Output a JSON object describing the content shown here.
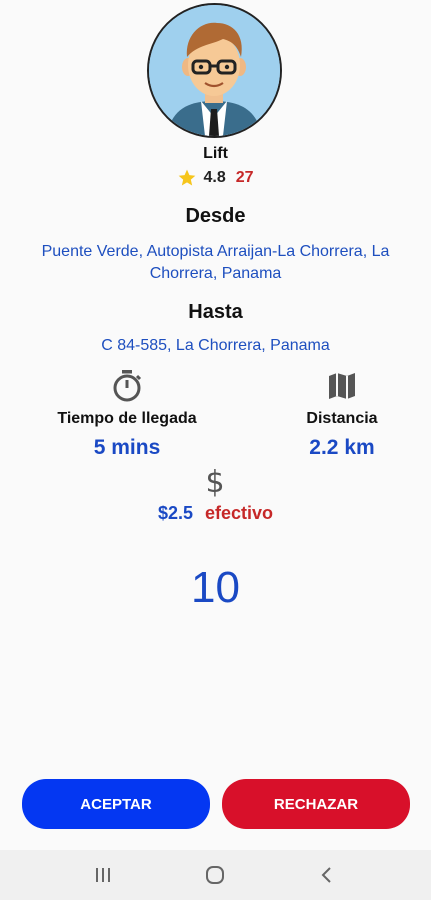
{
  "driver": {
    "name": "Lift",
    "rating": "4.8",
    "trips": "27"
  },
  "pickup": {
    "title": "Desde",
    "address": "Puente Verde, Autopista Arraijan-La Chorrera, La Chorrera, Panama"
  },
  "dropoff": {
    "title": "Hasta",
    "address": "C 84-585, La Chorrera, Panama"
  },
  "arrival": {
    "label": "Tiempo de llegada",
    "value": "5 mins",
    "icon": "stopwatch-icon"
  },
  "distance": {
    "label": "Distancia",
    "value": "2.2 km",
    "icon": "map-icon"
  },
  "payment": {
    "amount": "$2.5",
    "method": "efectivo",
    "icon": "dollar-icon"
  },
  "countdown": "10",
  "actions": {
    "accept_label": "ACEPTAR",
    "reject_label": "RECHAZAR"
  },
  "colors": {
    "accent_blue": "#1a49c4",
    "accept": "#0437f2",
    "reject": "#d8102a",
    "star": "#f6c51b"
  }
}
